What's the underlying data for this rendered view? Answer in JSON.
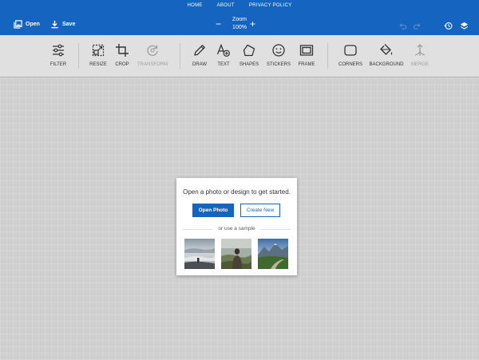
{
  "nav": {
    "links": [
      "HOME",
      "ABOUT",
      "PRIVACY POLICY"
    ]
  },
  "header": {
    "open_label": "Open",
    "save_label": "Save",
    "zoom_label": "Zoom",
    "zoom_value": "100%",
    "zoom_minus": "−",
    "zoom_plus": "+"
  },
  "toolbar": {
    "tools": [
      {
        "label": "FILTER",
        "icon": "sliders-icon",
        "enabled": true
      },
      {
        "label": "RESIZE",
        "icon": "resize-icon",
        "enabled": true
      },
      {
        "label": "CROP",
        "icon": "crop-icon",
        "enabled": true
      },
      {
        "label": "TRANSFORM",
        "icon": "rotate-icon",
        "enabled": false
      },
      {
        "label": "DRAW",
        "icon": "pencil-icon",
        "enabled": true
      },
      {
        "label": "TEXT",
        "icon": "text-icon",
        "enabled": true
      },
      {
        "label": "SHAPES",
        "icon": "pentagon-icon",
        "enabled": true
      },
      {
        "label": "STICKERS",
        "icon": "smiley-icon",
        "enabled": true
      },
      {
        "label": "FRAME",
        "icon": "frame-icon",
        "enabled": true
      },
      {
        "label": "CORNERS",
        "icon": "rounded-rect-icon",
        "enabled": true
      },
      {
        "label": "BACKGROUND",
        "icon": "paint-bucket-icon",
        "enabled": true
      },
      {
        "label": "MERGE",
        "icon": "merge-icon",
        "enabled": false
      }
    ]
  },
  "dialog": {
    "message": "Open a photo or design to get started.",
    "open_photo": "Open Photo",
    "create_new": "Create New",
    "sample_label": "or use a sample"
  },
  "colors": {
    "brand": "#1565c0",
    "toolbar_bg": "#e0e0e0",
    "canvas_bg": "#cfcfcf"
  }
}
